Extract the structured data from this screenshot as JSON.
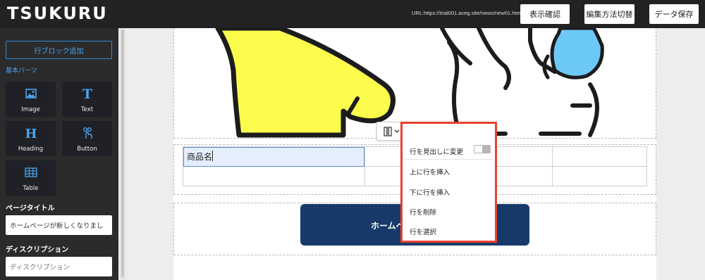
{
  "header": {
    "logo": "TSUKURU",
    "url": "URL:https://trial001.aceg.site/news/new01.html",
    "buttons": {
      "preview": "表示確認",
      "switch_mode": "編集方法切替",
      "save": "データ保存"
    }
  },
  "sidebar": {
    "add_row_block": "行ブロック追加",
    "basic_parts_title": "基本パーツ",
    "parts": [
      {
        "label": "Image",
        "icon": "image-icon"
      },
      {
        "label": "Text",
        "icon": "text-icon"
      },
      {
        "label": "Heading",
        "icon": "heading-icon"
      },
      {
        "label": "Button",
        "icon": "button-icon"
      },
      {
        "label": "Table",
        "icon": "table-icon"
      }
    ],
    "page_title_label": "ページタイトル",
    "page_title_value": "ホームページが新しくなりまし",
    "description_label": "ディスクリプション",
    "description_placeholder": "ディスクリプション"
  },
  "canvas": {
    "table": {
      "rows": [
        [
          "商品名",
          "",
          "",
          ""
        ],
        [
          "",
          "",
          "",
          ""
        ]
      ]
    },
    "cta_button_text": "ホームペ"
  },
  "row_menu": {
    "items": {
      "to_header": "行を見出しに変更",
      "insert_above": "上に行を挿入",
      "insert_below": "下に行を挿入",
      "delete": "行を削除",
      "select": "行を選択"
    },
    "toggle_on": false
  },
  "colors": {
    "accent": "#2a8bdc",
    "menu_highlight": "#e8412e",
    "cta": "#173a6a",
    "illustration_yellow": "#fcfc4c",
    "illustration_blue": "#6cc8f6"
  }
}
